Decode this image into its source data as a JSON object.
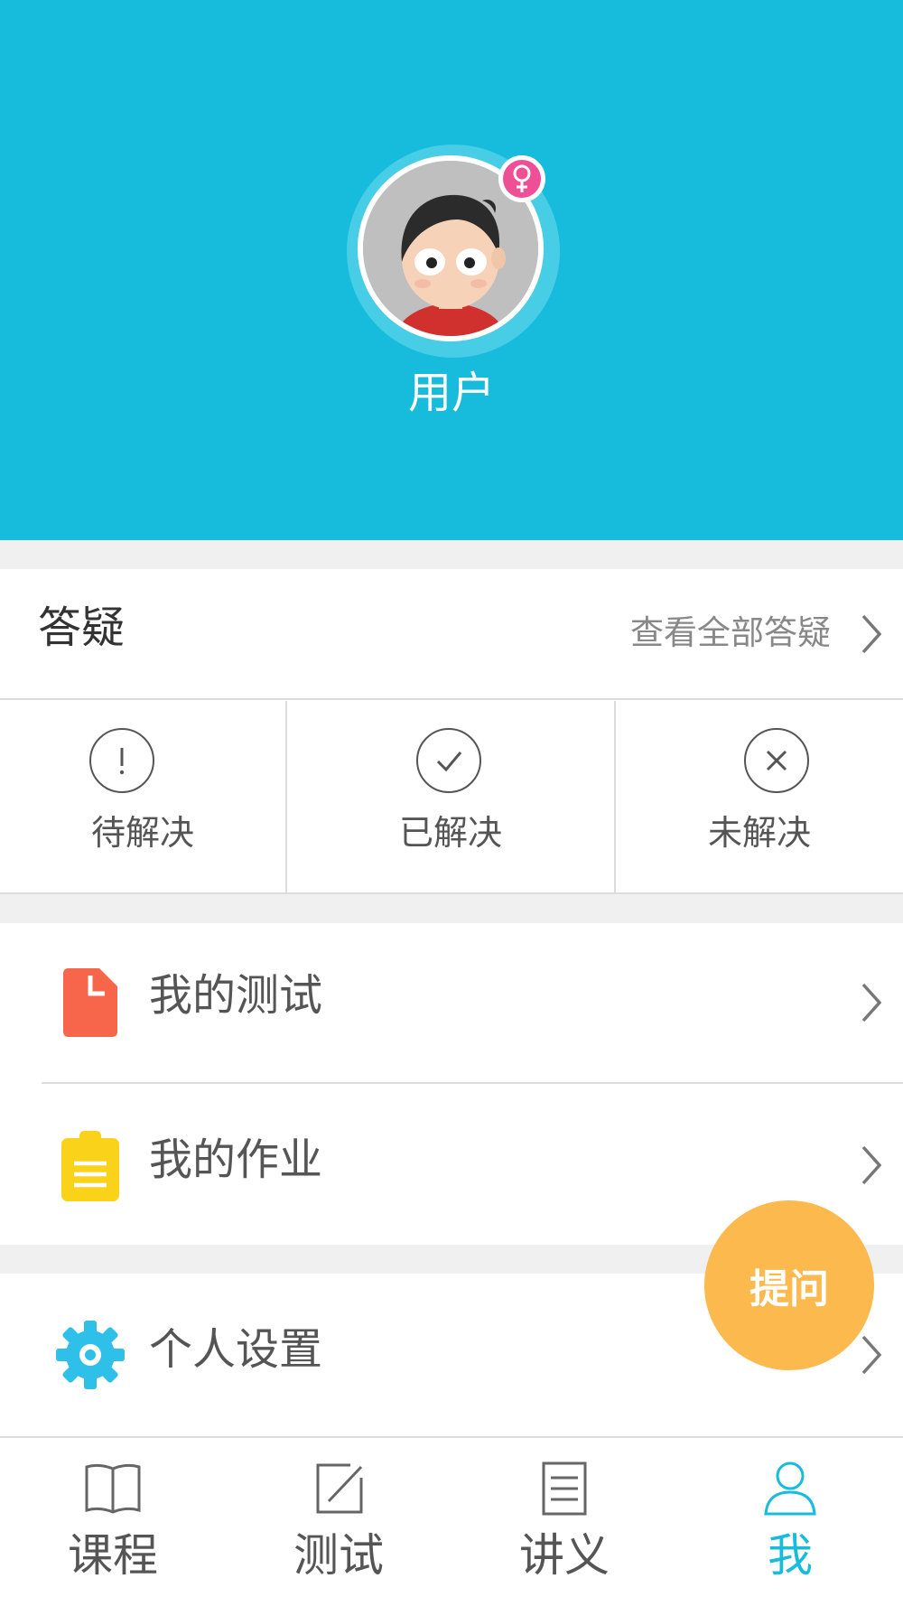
{
  "profile": {
    "username": "用户",
    "gender_icon": "female-symbol-icon",
    "header_color": "#17bcdc"
  },
  "qa": {
    "title": "答疑",
    "view_all": "查看全部答疑",
    "items": [
      {
        "label": "待解决",
        "icon": "exclamation-circle-icon"
      },
      {
        "label": "已解决",
        "icon": "check-circle-icon"
      },
      {
        "label": "未解决",
        "icon": "x-circle-icon"
      }
    ]
  },
  "menu": {
    "my_tests": "我的测试",
    "my_homework": "我的作业",
    "settings": "个人设置"
  },
  "fab": {
    "label": "提问",
    "color": "#fbb94e"
  },
  "nav": {
    "items": [
      {
        "label": "课程",
        "icon": "book-icon"
      },
      {
        "label": "测试",
        "icon": "edit-square-icon"
      },
      {
        "label": "讲义",
        "icon": "document-list-icon"
      },
      {
        "label": "我",
        "icon": "user-icon"
      }
    ],
    "active_index": 3,
    "active_color": "#17bcdc"
  }
}
